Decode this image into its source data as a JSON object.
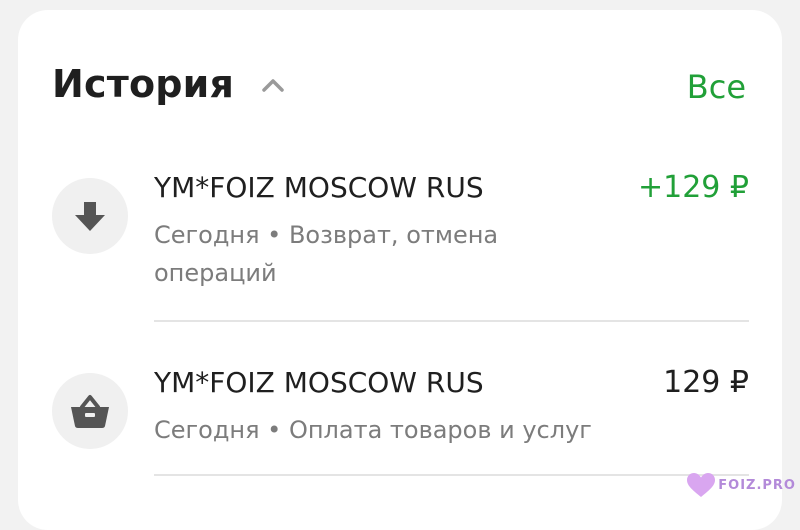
{
  "history": {
    "title": "История",
    "all_link": "Все",
    "transactions": [
      {
        "merchant": "YM*FOIZ MOSCOW RUS",
        "subtitle": "Сегодня • Возврат, отмена операций",
        "amount": "+129 ₽",
        "amount_color": "#21a038",
        "icon": "arrow-down-icon"
      },
      {
        "merchant": "YM*FOIZ MOSCOW RUS",
        "subtitle": "Сегодня • Оплата товаров и услуг",
        "amount": "129 ₽",
        "amount_color": "#1f1f1f",
        "icon": "basket-icon"
      }
    ]
  },
  "watermark": {
    "text": "FOIZ.PRO"
  },
  "colors": {
    "accent": "#21a038",
    "text": "#1f1f1f",
    "muted": "#7c7c7c",
    "icon_bg": "#f0f0f0",
    "icon": "#555555"
  }
}
